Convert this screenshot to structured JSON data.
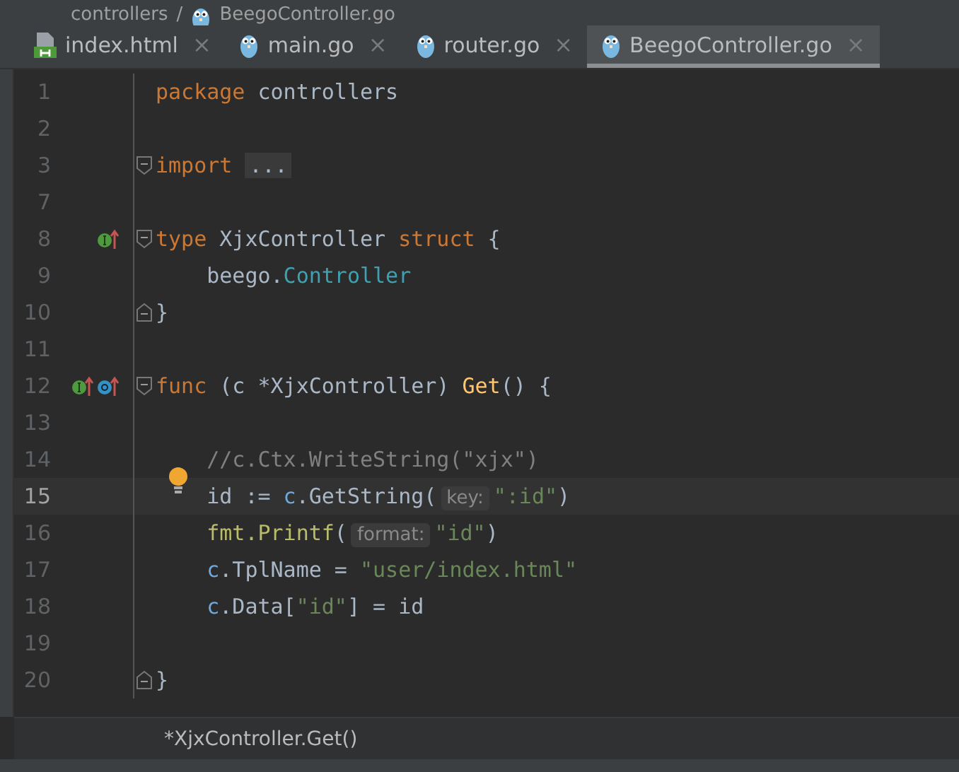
{
  "breadcrumb": {
    "items": [
      {
        "text": "controllers",
        "kind": "directory"
      },
      {
        "text": "BeegoController.go",
        "kind": "go"
      }
    ],
    "separator": "/"
  },
  "tabs": [
    {
      "label": "index.html",
      "kind": "html",
      "close": "×",
      "selected": false
    },
    {
      "label": "main.go",
      "kind": "go",
      "close": "×",
      "selected": false
    },
    {
      "label": "router.go",
      "kind": "go",
      "close": "×",
      "selected": false
    },
    {
      "label": "BeegoController.go",
      "kind": "go",
      "close": "×",
      "selected": true
    }
  ],
  "editor": {
    "lines": [
      {
        "number": "1",
        "current": false,
        "indented": false,
        "tokens": [
          {
            "kind": "keyword",
            "text": "package"
          },
          {
            "kind": "plain",
            "text": " controllers"
          }
        ]
      },
      {
        "number": "2",
        "current": false,
        "indented": false
      },
      {
        "number": "3",
        "current": false,
        "indented": false,
        "fold_start": true,
        "tokens": [
          {
            "kind": "keyword",
            "text": "import"
          },
          {
            "kind": "folded",
            "text": "..."
          }
        ]
      },
      {
        "number": "7",
        "current": false,
        "indented": false
      },
      {
        "number": "8",
        "current": false,
        "indented": false,
        "fold_start": true,
        "implemented": true,
        "tokens": [
          {
            "kind": "keyword",
            "text": "type"
          },
          {
            "kind": "plain",
            "text": " XjxController "
          },
          {
            "kind": "keyword",
            "text": "struct"
          },
          {
            "kind": "plain",
            "text": " {"
          }
        ]
      },
      {
        "number": "9",
        "current": false,
        "indented": true,
        "tokens": [
          {
            "kind": "plain",
            "text": "beego."
          },
          {
            "kind": "field",
            "text": "Controller"
          }
        ]
      },
      {
        "number": "10",
        "current": false,
        "indented": false,
        "fold_end": true,
        "tokens": [
          {
            "kind": "plain",
            "text": "}"
          }
        ]
      },
      {
        "number": "11",
        "current": false,
        "indented": false
      },
      {
        "number": "12",
        "current": false,
        "indented": false,
        "fold_start": true,
        "implemented": true,
        "overriding": true,
        "tokens": [
          {
            "kind": "keyword",
            "text": "func"
          },
          {
            "kind": "plain",
            "text": " (c *XjxController) "
          },
          {
            "kind": "method",
            "text": "Get"
          },
          {
            "kind": "plain",
            "text": "() {"
          }
        ]
      },
      {
        "number": "13",
        "current": false,
        "indented": false
      },
      {
        "number": "14",
        "current": false,
        "indented": true,
        "tokens": [
          {
            "kind": "comment",
            "text": "//c.Ctx.WriteString(\"xjx\")"
          }
        ]
      },
      {
        "number": "15",
        "current": true,
        "indented": true,
        "bulb": true,
        "tokens": [
          {
            "kind": "plain",
            "text": "id := "
          },
          {
            "kind": "receiver",
            "text": "c"
          },
          {
            "kind": "plain",
            "text": ".GetString("
          },
          {
            "kind": "hint",
            "text": "key:"
          },
          {
            "kind": "string",
            "text": "\":id\""
          },
          {
            "kind": "plain",
            "text": ")"
          }
        ]
      },
      {
        "number": "16",
        "current": false,
        "indented": true,
        "tokens": [
          {
            "kind": "call",
            "text": "fmt.Printf"
          },
          {
            "kind": "plain",
            "text": "("
          },
          {
            "kind": "hint",
            "text": "format:"
          },
          {
            "kind": "string",
            "text": "\"id\""
          },
          {
            "kind": "plain",
            "text": ")"
          }
        ]
      },
      {
        "number": "17",
        "current": false,
        "indented": true,
        "tokens": [
          {
            "kind": "receiver",
            "text": "c"
          },
          {
            "kind": "plain",
            "text": ".TplName = "
          },
          {
            "kind": "string",
            "text": "\"user/index.html\""
          }
        ]
      },
      {
        "number": "18",
        "current": false,
        "indented": true,
        "tokens": [
          {
            "kind": "receiver",
            "text": "c"
          },
          {
            "kind": "plain",
            "text": ".Data["
          },
          {
            "kind": "string",
            "text": "\"id\""
          },
          {
            "kind": "plain",
            "text": "] = id"
          }
        ]
      },
      {
        "number": "19",
        "current": false,
        "indented": false
      },
      {
        "number": "20",
        "current": false,
        "indented": false,
        "fold_end": true,
        "tokens": [
          {
            "kind": "plain",
            "text": "}"
          }
        ]
      }
    ]
  },
  "status": {
    "breadcrumb": "*XjxController.Get()"
  }
}
